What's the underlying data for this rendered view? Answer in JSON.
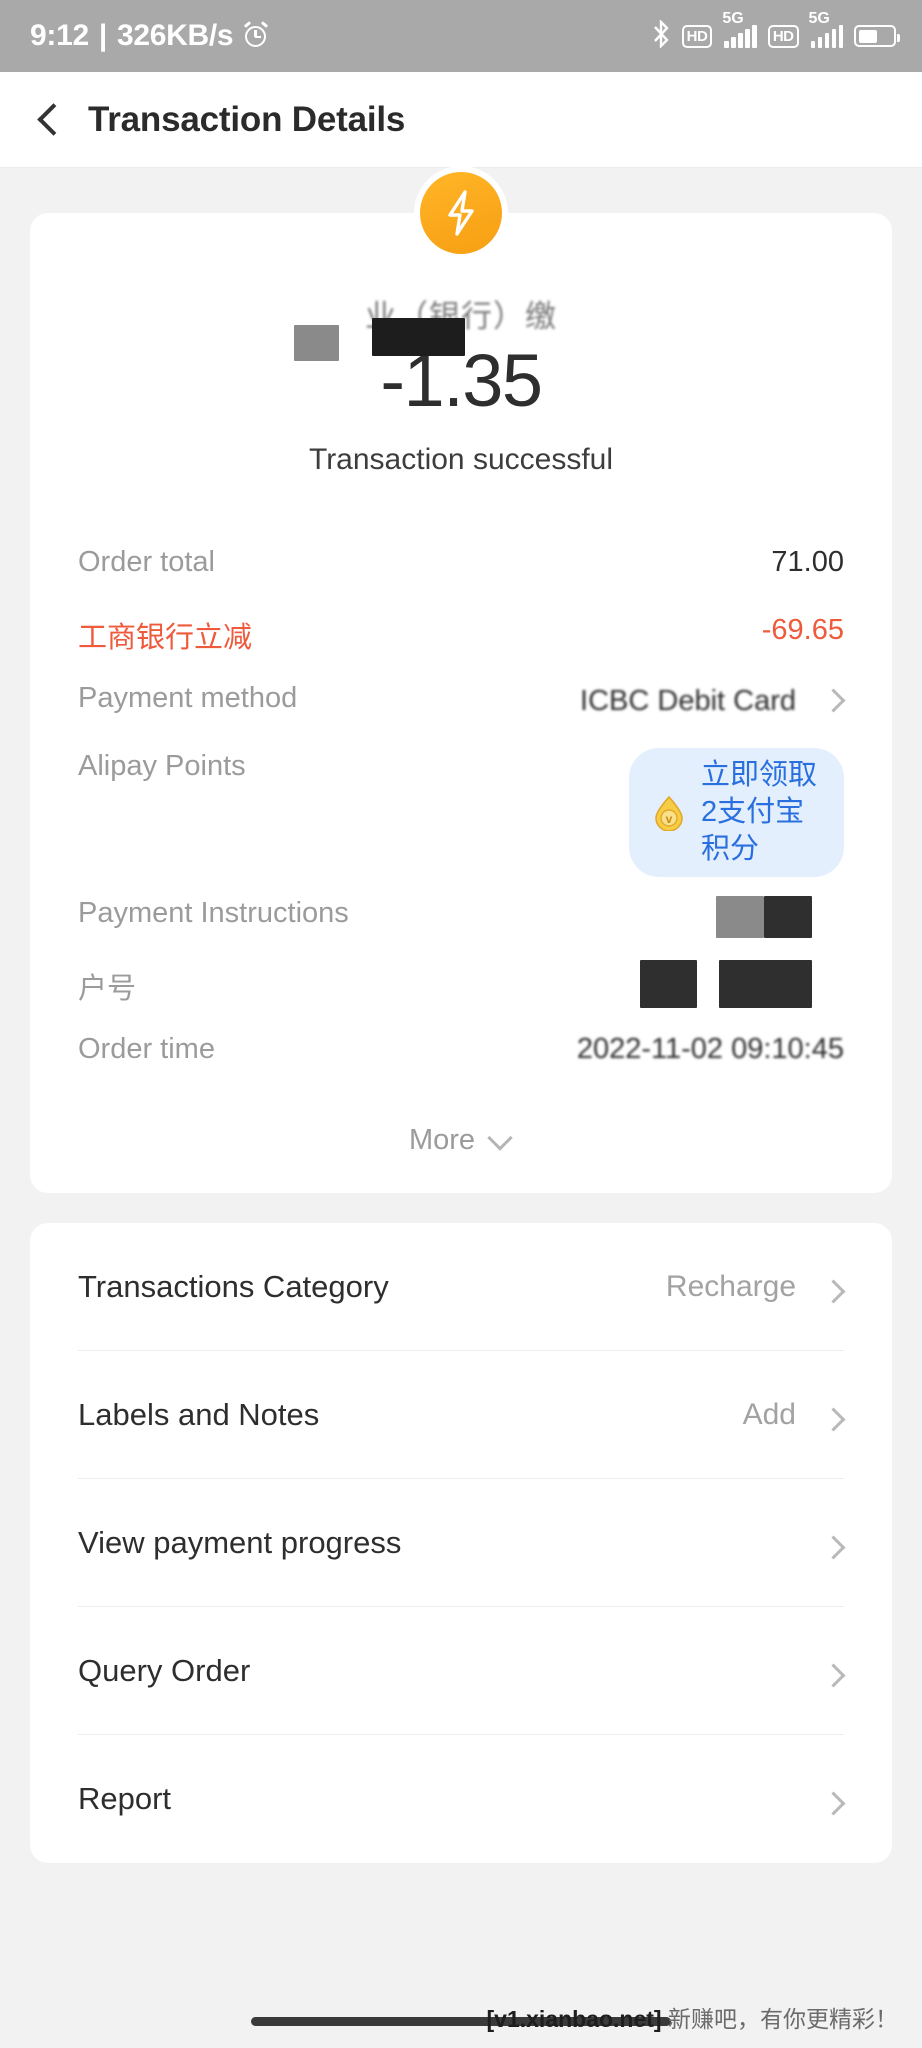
{
  "status_bar": {
    "time": "9:12",
    "separator": "|",
    "network_speed": "326KB/s",
    "alarm_icon": "alarm-clock-icon",
    "bluetooth_icon": "bluetooth-icon",
    "bluetooth_glyph": "ᛦ",
    "hd_label": "HD",
    "network_label": "5G",
    "battery_level_pct": 55
  },
  "header": {
    "back_icon": "back-chevron-icon",
    "title": "Transaction Details"
  },
  "summary": {
    "badge_icon": "lightning-bolt-icon",
    "merchant_name": "业（银行）缴",
    "amount": "-1.35",
    "status": "Transaction successful"
  },
  "details": [
    {
      "label": "Order total",
      "value": "71.00",
      "accent": false,
      "chevron": false
    },
    {
      "label": "工商银行立减",
      "value": "-69.65",
      "accent": true,
      "chevron": false
    },
    {
      "label": "Payment method",
      "value": "ICBC Debit Card",
      "accent": false,
      "chevron": true
    },
    {
      "label": "Alipay Points",
      "value": "立即领取2支付宝积分",
      "accent": false,
      "chevron": false
    },
    {
      "label": "Payment Instructions",
      "value": "",
      "accent": false,
      "chevron": false
    },
    {
      "label": "户号",
      "value": "",
      "accent": false,
      "chevron": false
    },
    {
      "label": "Order time",
      "value": "2022-11-02 09:10:45",
      "accent": false,
      "chevron": false
    }
  ],
  "more": {
    "label": "More",
    "icon": "chevron-down-icon"
  },
  "list_rows": [
    {
      "title": "Transactions Category",
      "value": "Recharge",
      "chevron_icon": "chevron-right-icon"
    },
    {
      "title": "Labels and Notes",
      "value": "Add",
      "chevron_icon": "chevron-right-icon"
    },
    {
      "title": "View payment progress",
      "value": "",
      "chevron_icon": "chevron-right-icon"
    },
    {
      "title": "Query Order",
      "value": "",
      "chevron_icon": "chevron-right-icon"
    },
    {
      "title": "Report",
      "value": "",
      "chevron_icon": "chevron-right-icon"
    }
  ],
  "footer": {
    "watermark_site": "[v1.xianbao.net]",
    "watermark_text": " 新赚吧，有你更精彩！"
  },
  "colors": {
    "accent_red": "#ef5a3c",
    "badge_orange": "#fba71b",
    "pill_bg": "#e3effd",
    "pill_text": "#2a6fe0",
    "status_bar_bg": "#a9a9a9",
    "page_bg": "#f2f2f2"
  }
}
